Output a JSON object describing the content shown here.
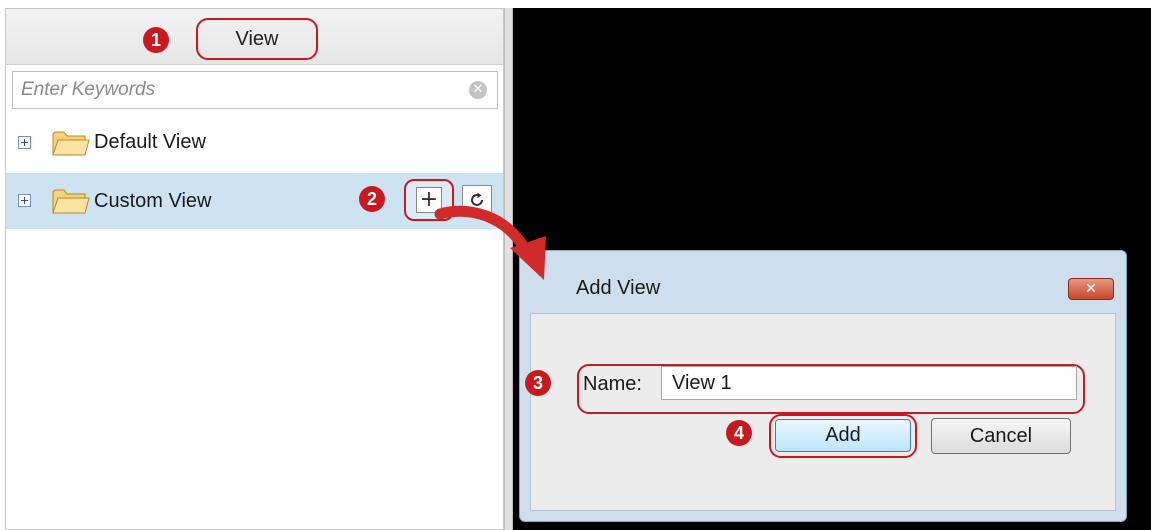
{
  "panel": {
    "tab_label": "View",
    "search_placeholder": "Enter Keywords",
    "tree": [
      {
        "label": "Default View"
      },
      {
        "label": "Custom View"
      }
    ]
  },
  "dialog": {
    "title": "Add View",
    "close_glyph": "✕",
    "name_label": "Name:",
    "name_value": "View 1",
    "add_label": "Add",
    "cancel_label": "Cancel"
  },
  "steps": [
    "1",
    "2",
    "3",
    "4"
  ],
  "icons": {
    "expand": "plus-square-icon",
    "folder": "folder-icon",
    "add": "plus-icon",
    "refresh": "refresh-icon",
    "clear": "clear-icon",
    "close": "close-icon"
  },
  "colors": {
    "annotation": "#c8191f",
    "selected_row": "#cde3f2",
    "video_bg": "#000000",
    "dialog_frame": "#cfdeed"
  }
}
